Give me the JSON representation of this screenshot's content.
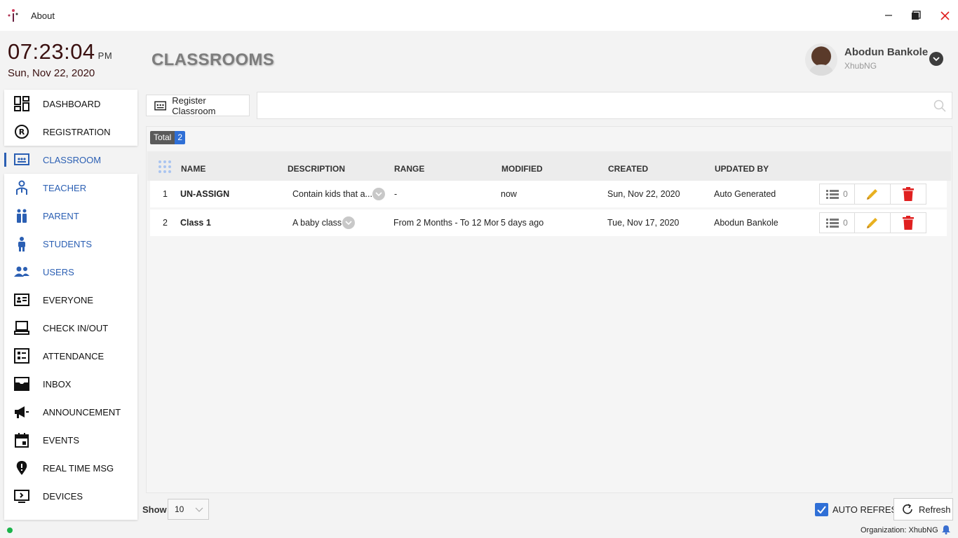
{
  "window": {
    "title": "About"
  },
  "header": {
    "time": "07:23:04",
    "ampm": "PM",
    "date": "Sun, Nov 22, 2020",
    "page_title": "CLASSROOMS",
    "user_name": "Abodun Bankole",
    "user_org": "XhubNG"
  },
  "sidebar": {
    "items": [
      {
        "label": "DASHBOARD",
        "icon": "dashboard-icon"
      },
      {
        "label": "REGISTRATION",
        "icon": "registered-icon"
      },
      {
        "label": "CLASSROOM",
        "icon": "classroom-icon"
      },
      {
        "label": "TEACHER",
        "icon": "teacher-icon"
      },
      {
        "label": "PARENT",
        "icon": "parent-icon"
      },
      {
        "label": "STUDENTS",
        "icon": "student-icon"
      },
      {
        "label": "USERS",
        "icon": "users-icon"
      },
      {
        "label": "EVERYONE",
        "icon": "id-card-icon"
      },
      {
        "label": "CHECK IN/OUT",
        "icon": "laptop-icon"
      },
      {
        "label": "ATTENDANCE",
        "icon": "checklist-icon"
      },
      {
        "label": "INBOX",
        "icon": "inbox-icon"
      },
      {
        "label": "ANNOUNCEMENT",
        "icon": "megaphone-icon"
      },
      {
        "label": "EVENTS",
        "icon": "calendar-icon"
      },
      {
        "label": "REAL TIME MSG",
        "icon": "location-pin-icon"
      },
      {
        "label": "DEVICES",
        "icon": "devices-icon"
      }
    ]
  },
  "toolbar": {
    "register_label": "Register Classroom",
    "search_placeholder": "",
    "search_value": ""
  },
  "table": {
    "total_label": "Total",
    "total_count": "2",
    "columns": [
      "NAME",
      "DESCRIPTION",
      "RANGE",
      "MODIFIED",
      "CREATED",
      "UPDATED BY"
    ],
    "rows": [
      {
        "index": "1",
        "name": "UN-ASSIGN",
        "description": "Contain kids that a...",
        "range": "-",
        "modified": "now",
        "created": "Sun, Nov 22, 2020",
        "updated_by": "Auto Generated",
        "count": "0"
      },
      {
        "index": "2",
        "name": "Class 1",
        "description": "A baby class",
        "range": "From 2 Months - To 12 Mon",
        "modified": "5 days ago",
        "created": "Tue, Nov 17, 2020",
        "updated_by": "Abodun Bankole",
        "count": "0"
      }
    ]
  },
  "footer": {
    "show_label": "Show",
    "show_value": "10",
    "auto_refresh_label": "AUTO REFRESH",
    "refresh_label": "Refresh",
    "organization": "Organization: XhubNG"
  },
  "colors": {
    "accent": "#2f6fd6",
    "nav_blue": "#2b5fb3",
    "delete": "#e02020",
    "edit": "#e8b020"
  }
}
